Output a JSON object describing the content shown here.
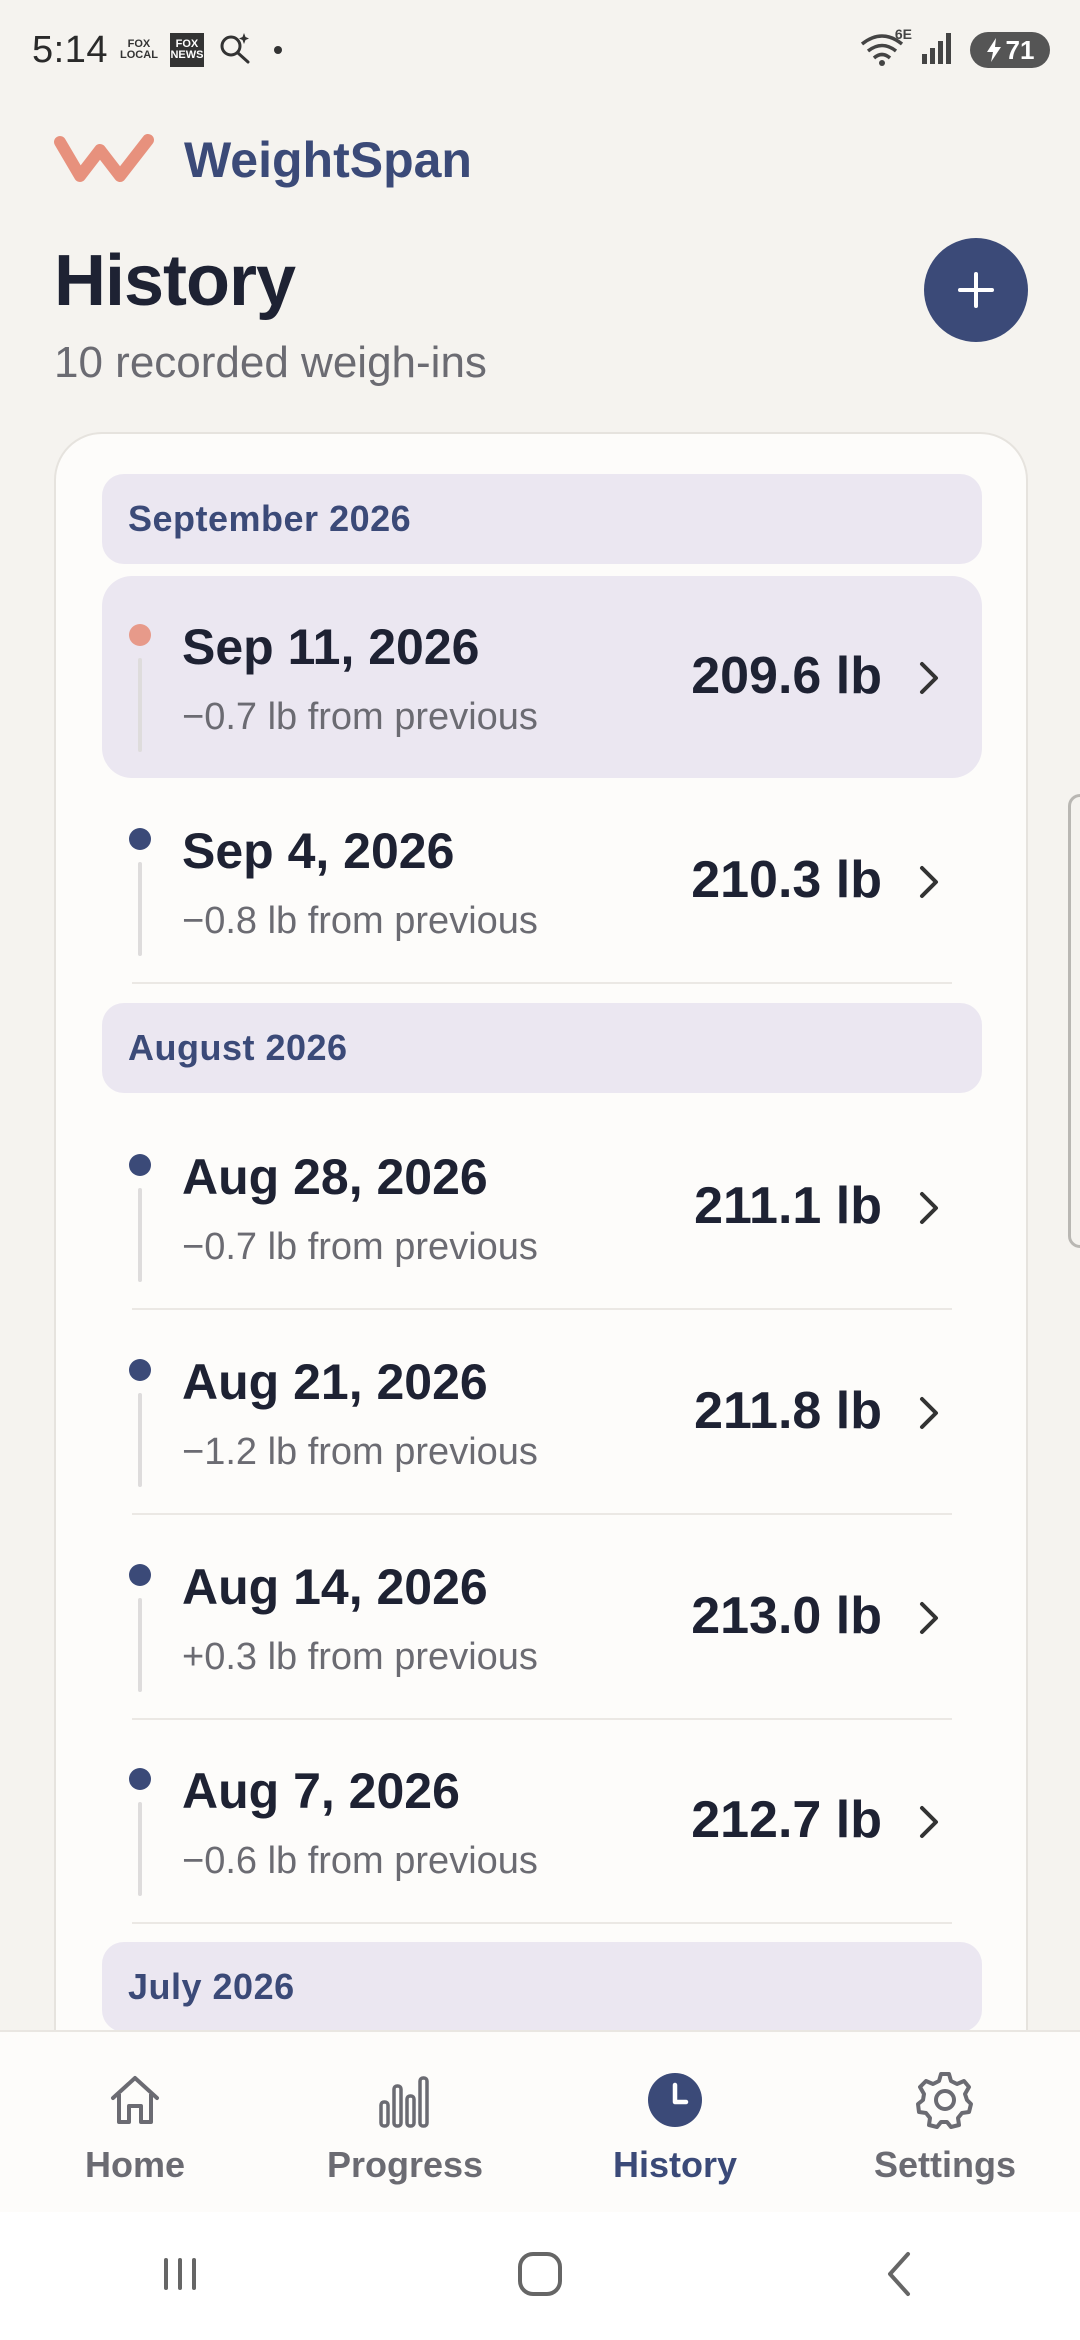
{
  "status_bar": {
    "time": "5:14",
    "icons": [
      "fox-local-icon",
      "fox-news-icon",
      "search-sparkle-icon",
      "notification-dot-icon",
      "wifi-6e-icon",
      "signal-icon"
    ],
    "fox_local_text": "FOX LOCAL",
    "fox_news_text": "FOX NEWS",
    "wifi_label": "6E",
    "battery_level": "71"
  },
  "app": {
    "name": "WeightSpan",
    "brand_color": "#3b4a78",
    "accent_color": "#e79a8a"
  },
  "page": {
    "title": "History",
    "subtitle": "10 recorded weigh-ins"
  },
  "add_button": {
    "icon": "plus-icon"
  },
  "history": {
    "months": [
      {
        "label": "September 2026",
        "entries": [
          {
            "date": "Sep 11, 2026",
            "delta": "−0.7 lb from previous",
            "weight": "209.6 lb",
            "selected": true
          },
          {
            "date": "Sep 4, 2026",
            "delta": "−0.8 lb from previous",
            "weight": "210.3 lb",
            "selected": false
          }
        ]
      },
      {
        "label": "August 2026",
        "entries": [
          {
            "date": "Aug 28, 2026",
            "delta": "−0.7 lb from previous",
            "weight": "211.1 lb",
            "selected": false
          },
          {
            "date": "Aug 21, 2026",
            "delta": "−1.2 lb from previous",
            "weight": "211.8 lb",
            "selected": false
          },
          {
            "date": "Aug 14, 2026",
            "delta": "+0.3 lb from previous",
            "weight": "213.0 lb",
            "selected": false
          },
          {
            "date": "Aug 7, 2026",
            "delta": "−0.6 lb from previous",
            "weight": "212.7 lb",
            "selected": false
          }
        ]
      },
      {
        "label": "July 2026",
        "entries": []
      }
    ]
  },
  "bottom_nav": {
    "items": [
      {
        "label": "Home",
        "icon": "home-icon",
        "active": false
      },
      {
        "label": "Progress",
        "icon": "bar-chart-icon",
        "active": false
      },
      {
        "label": "History",
        "icon": "clock-icon",
        "active": true
      },
      {
        "label": "Settings",
        "icon": "gear-icon",
        "active": false
      }
    ]
  },
  "system_nav": {
    "icons": [
      "recent-apps-icon",
      "home-circle-icon",
      "back-icon"
    ]
  }
}
